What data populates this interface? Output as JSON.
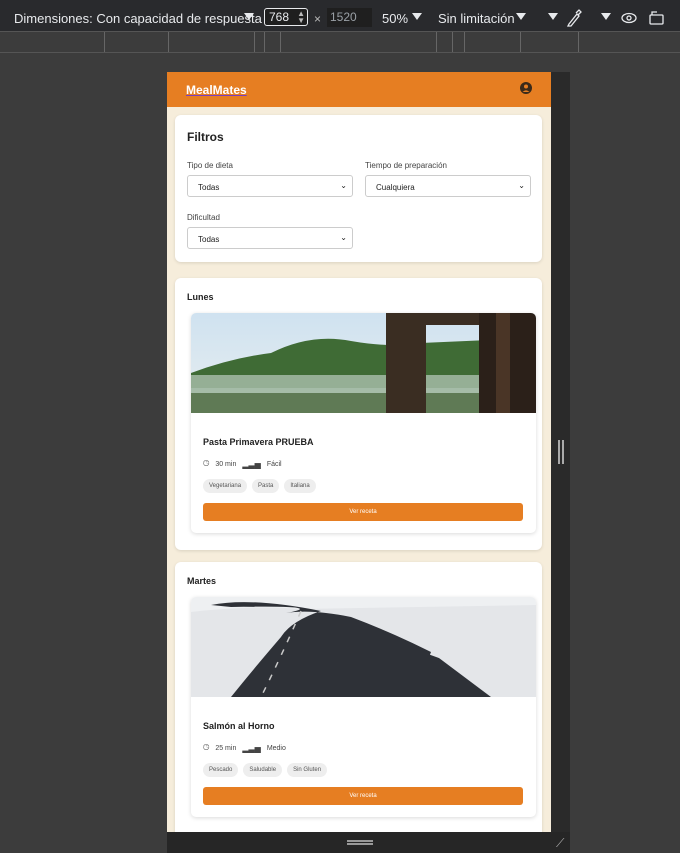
{
  "devtools": {
    "dimensions_label": "Dimensiones: Con capacidad de respuesta",
    "width_value": "768",
    "times_symbol": "×",
    "height_value": "1520",
    "zoom": "50%",
    "throttle": "Sin limitación"
  },
  "app": {
    "brand": "MealMates"
  },
  "filters": {
    "title": "Filtros",
    "diet_label": "Tipo de dieta",
    "diet_value": "Todas",
    "prep_label": "Tiempo de preparación",
    "prep_value": "Cualquiera",
    "difficulty_label": "Dificultad",
    "difficulty_value": "Todas"
  },
  "days": [
    {
      "day": "Lunes",
      "recipe": {
        "name": "Pasta Primavera PRUEBA",
        "time": "30 min",
        "difficulty": "Fácil",
        "tags": [
          "Vegetariana",
          "Pasta",
          "Italiana"
        ],
        "button": "Ver receta"
      }
    },
    {
      "day": "Martes",
      "recipe": {
        "name": "Salmón al Horno",
        "time": "25 min",
        "difficulty": "Medio",
        "tags": [
          "Pescado",
          "Saludable",
          "Sin Gluten"
        ],
        "button": "Ver receta"
      }
    }
  ],
  "colors": {
    "accent": "#e67e22",
    "page_bg": "#f6eddb"
  }
}
